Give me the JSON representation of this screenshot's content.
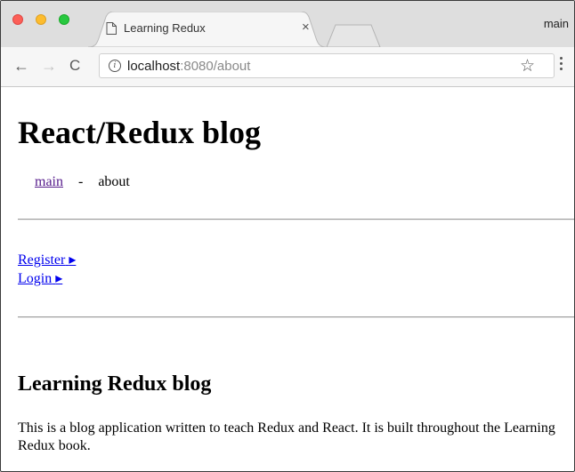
{
  "browser": {
    "tab": {
      "title": "Learning Redux",
      "close_glyph": "×"
    },
    "profile_label": "main",
    "toolbar": {
      "back_glyph": "←",
      "forward_glyph": "→",
      "reload_glyph": "C",
      "info_glyph": "i",
      "url_host": "localhost",
      "url_rest": ":8080/about",
      "star_glyph": "☆"
    },
    "traffic_light_colors": {
      "close": "#fc5f57",
      "minimize": "#fdbc2e",
      "maximize": "#28c840"
    }
  },
  "page": {
    "title": "React/Redux blog",
    "nav": {
      "main_link": "main",
      "separator": "-",
      "current": "about"
    },
    "auth_links": [
      {
        "label": "Register",
        "arrow": "▸"
      },
      {
        "label": "Login",
        "arrow": "▸"
      }
    ],
    "heading": "Learning Redux blog",
    "description": "This is a blog application written to teach Redux and React. It is built throughout the Learning Redux book."
  }
}
